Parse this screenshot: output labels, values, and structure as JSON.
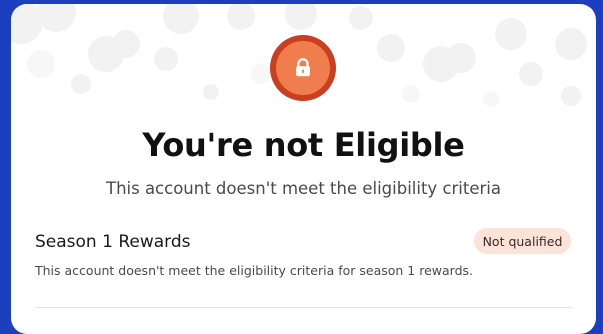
{
  "dialog": {
    "title": "You're not Eligible",
    "subtitle": "This account doesn't meet the eligibility criteria",
    "icon": "lock-icon",
    "colors": {
      "icon_ring": "#c93f1f",
      "icon_fill": "#ef7d4d",
      "backdrop": "#1c3fbf",
      "badge_bg": "#fbe3da"
    }
  },
  "rewards": {
    "title": "Season 1 Rewards",
    "status": "Not qualified",
    "description": "This account doesn't meet the eligibility criteria for season 1 rewards."
  }
}
